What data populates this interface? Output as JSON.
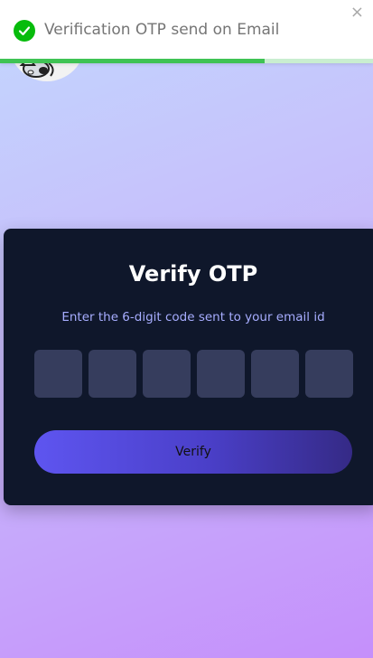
{
  "toast": {
    "message": "Verification OTP send on Email",
    "close_symbol": "×",
    "icon": "check-circle-icon",
    "progress": 0.71,
    "colors": {
      "success": "#07bc0c",
      "progress": "#3fc354",
      "track": "#c9eed0"
    }
  },
  "header": {
    "logo_icon": "cartoon-logo-icon"
  },
  "otp_card": {
    "title": "Verify OTP",
    "subtitle": "Enter the 6-digit code sent to your email id",
    "otp_digits": [
      "",
      "",
      "",
      "",
      "",
      ""
    ],
    "verify_label": "Verify",
    "colors": {
      "card_bg": "#0f172b",
      "box_bg": "#363d5d",
      "accent": "#a7adff"
    }
  }
}
